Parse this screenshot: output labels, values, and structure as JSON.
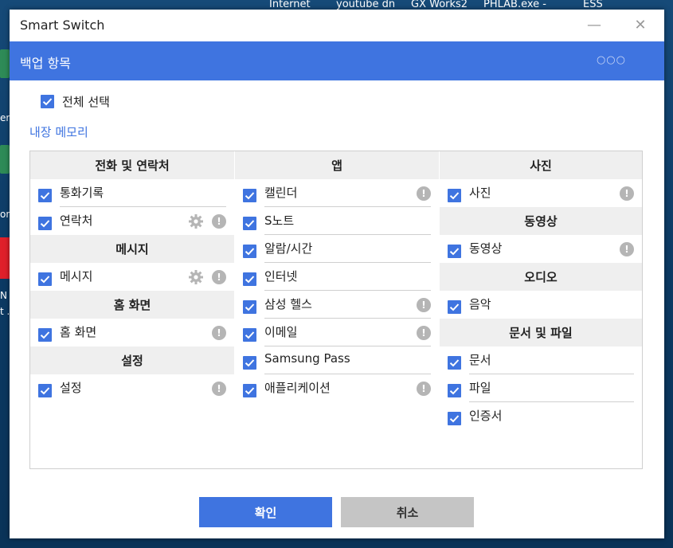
{
  "taskbar": [
    "Internet",
    "youtube dn",
    "GX Works2",
    "PHLAB.exe -",
    "ESS"
  ],
  "desktop_labels": [
    "er",
    "or",
    "N",
    "t .."
  ],
  "window": {
    "title": "Smart Switch",
    "minimize_icon": "minimize-icon",
    "close_icon": "close-icon"
  },
  "header": {
    "title": "백업 항목",
    "more": "○○○"
  },
  "select_all": {
    "label": "전체 선택",
    "checked": true
  },
  "memory_label": "내장 메모리",
  "columns": [
    {
      "sections": [
        {
          "title": "전화 및 연락처",
          "items": [
            {
              "label": "통화기록",
              "checked": true,
              "gear": false,
              "info": false,
              "divider": true
            },
            {
              "label": "연락처",
              "checked": true,
              "gear": true,
              "info": true,
              "divider": false
            }
          ]
        },
        {
          "title": "메시지",
          "items": [
            {
              "label": "메시지",
              "checked": true,
              "gear": true,
              "info": true,
              "divider": false
            }
          ]
        },
        {
          "title": "홈 화면",
          "items": [
            {
              "label": "홈 화면",
              "checked": true,
              "gear": false,
              "info": true,
              "divider": false
            }
          ]
        },
        {
          "title": "설정",
          "items": [
            {
              "label": "설정",
              "checked": true,
              "gear": false,
              "info": true,
              "divider": false
            }
          ]
        }
      ]
    },
    {
      "sections": [
        {
          "title": "앱",
          "items": [
            {
              "label": "캘린더",
              "checked": true,
              "gear": false,
              "info": true,
              "divider": true
            },
            {
              "label": "S노트",
              "checked": true,
              "gear": false,
              "info": false,
              "divider": true
            },
            {
              "label": "알람/시간",
              "checked": true,
              "gear": false,
              "info": false,
              "divider": true
            },
            {
              "label": "인터넷",
              "checked": true,
              "gear": false,
              "info": false,
              "divider": true
            },
            {
              "label": "삼성 헬스",
              "checked": true,
              "gear": false,
              "info": true,
              "divider": true
            },
            {
              "label": "이메일",
              "checked": true,
              "gear": false,
              "info": true,
              "divider": true
            },
            {
              "label": "Samsung Pass",
              "checked": true,
              "gear": false,
              "info": false,
              "divider": true
            },
            {
              "label": "애플리케이션",
              "checked": true,
              "gear": false,
              "info": true,
              "divider": false
            }
          ]
        }
      ]
    },
    {
      "sections": [
        {
          "title": "사진",
          "items": [
            {
              "label": "사진",
              "checked": true,
              "gear": false,
              "info": true,
              "divider": false
            }
          ]
        },
        {
          "title": "동영상",
          "items": [
            {
              "label": "동영상",
              "checked": true,
              "gear": false,
              "info": true,
              "divider": false
            }
          ]
        },
        {
          "title": "오디오",
          "items": [
            {
              "label": "음악",
              "checked": true,
              "gear": false,
              "info": false,
              "divider": false
            }
          ]
        },
        {
          "title": "문서 및 파일",
          "items": [
            {
              "label": "문서",
              "checked": true,
              "gear": false,
              "info": false,
              "divider": true
            },
            {
              "label": "파일",
              "checked": true,
              "gear": false,
              "info": false,
              "divider": true
            },
            {
              "label": "인증서",
              "checked": true,
              "gear": false,
              "info": false,
              "divider": false
            }
          ]
        }
      ]
    }
  ],
  "info_glyph": "!",
  "buttons": {
    "ok": "확인",
    "cancel": "취소"
  },
  "colors": {
    "accent": "#3f74e0",
    "section_bg": "#efefef",
    "info_icon": "#b5b5b5"
  }
}
